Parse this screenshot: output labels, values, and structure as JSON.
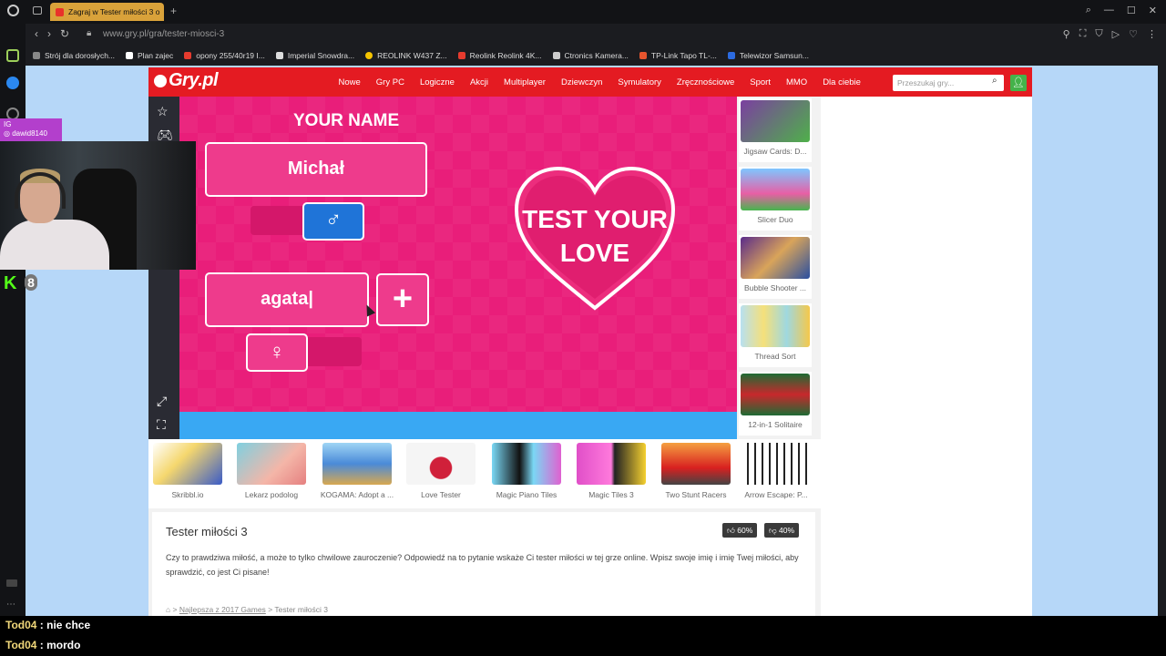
{
  "browser": {
    "tab_title": "Zagraj w Tester miłości 3 o",
    "add_tab": "+",
    "url": "www.gry.pl/gra/tester-miosci-3",
    "bookmarks": [
      "Strój dla dorosłych...",
      "Plan zajec",
      "opony 255/40r19 I...",
      "Imperial Snowdra...",
      "REOLINK W437 Z...",
      "Reolink Reolink 4K...",
      "Ctronics Kamera...",
      "TP-Link Tapo TL-...",
      "Telewizor Samsun..."
    ]
  },
  "site": {
    "logo": "Gry.pl",
    "nav": [
      "Nowe",
      "Gry PC",
      "Logiczne",
      "Akcji",
      "Multiplayer",
      "Dziewczyn",
      "Symulatory",
      "Zręcznościowe",
      "Sport",
      "MMO",
      "Dla ciebie"
    ],
    "search_placeholder": "Przeszukaj gry..."
  },
  "game": {
    "your_name": "YOUR NAME",
    "name1": "Michał",
    "name2": "agata|",
    "male_symbol": "♂",
    "female_symbol": "♀",
    "plus": "+",
    "heart_line1": "TEST YOUR",
    "heart_line2": "LOVE"
  },
  "side_games": [
    "Jigsaw Cards: D...",
    "Slicer Duo",
    "Bubble Shooter ...",
    "Thread Sort",
    "12-in-1 Solitaire"
  ],
  "bottom_games": [
    "Skribbl.io",
    "Lekarz podolog",
    "KOGAMA: Adopt a ...",
    "Love Tester",
    "Magic Piano Tiles",
    "Magic Tiles 3",
    "Two Stunt Racers",
    "Arrow Escape: P..."
  ],
  "description": {
    "title": "Tester miłości 3",
    "upvotes": "60%",
    "downvotes": "40%",
    "text": "Czy to prawdziwa miłość, a może to tylko chwilowe zauroczenie? Odpowiedź na to pytanie wskaże Ci tester miłości w tej grze online. Wpisz swoje imię i imię Twej miłości, aby sprawdzić, co jest Ci pisane!",
    "breadcrumb_1": "Najlepsza z 2017 Games",
    "breadcrumb_2": "Tester miłości 3"
  },
  "overlay": {
    "ig_line1": "IG",
    "ig_handle": "dawid8140",
    "kick_logo": "K",
    "kick_count": "8"
  },
  "chat": [
    {
      "user": "Tod04",
      "msg": " : nie chce"
    },
    {
      "user": "Tod04",
      "msg": " : mordo"
    }
  ],
  "colors": {
    "site_red": "#e41b22",
    "game_pink": "#e91e7a",
    "male_blue": "#1f74d8",
    "game_bar_blue": "#39a8f3"
  }
}
